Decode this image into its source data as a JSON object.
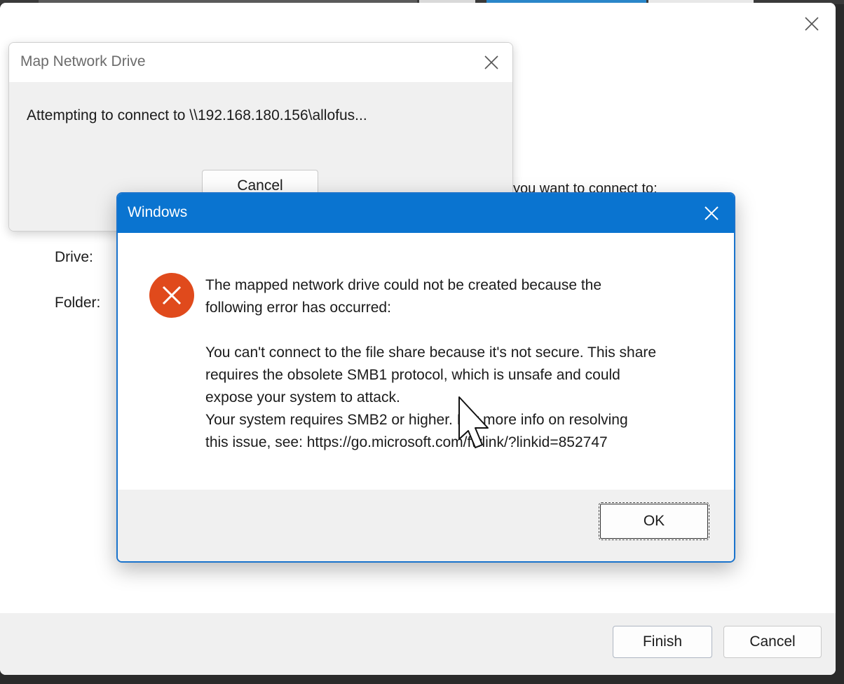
{
  "wizard": {
    "prompt": "you want to connect to:",
    "drive_label": "Drive:",
    "folder_label": "Folder:",
    "finish_label": "Finish",
    "cancel_label": "Cancel"
  },
  "map_dialog": {
    "title": "Map Network Drive",
    "status": "Attempting to connect to \\\\192.168.180.156\\allofus...",
    "cancel_label": "Cancel"
  },
  "error_dialog": {
    "title": "Windows",
    "line1": "The mapped network drive could not be created because the",
    "line2": "following error has occurred:",
    "line3": "You can't connect to the file share because it's not secure. This share",
    "line4": "requires the obsolete SMB1 protocol, which is unsafe and could",
    "line5": "expose your system to attack.",
    "line6": "Your system requires SMB2 or higher. For more info on resolving",
    "line7": "this issue, see: https://go.microsoft.com/fwlink/?linkid=852747",
    "ok_label": "OK",
    "icon": "error-x-icon"
  },
  "colors": {
    "titlebar_blue": "#0a74d0",
    "error_red": "#e04a1c"
  }
}
